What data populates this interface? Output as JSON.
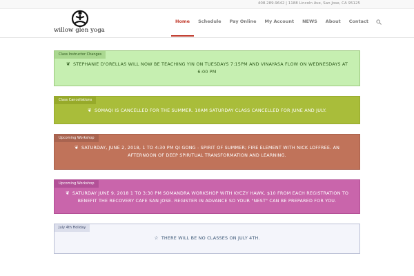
{
  "topbar": {
    "contact": "408.289.9642 | 1188 Lincoln Ave, San Jose, CA 95125"
  },
  "logo": {
    "name": "willow glen yoga",
    "icon": "yoga-figure-icon"
  },
  "nav": {
    "items": [
      {
        "label": "Home",
        "active": true
      },
      {
        "label": "Schedule"
      },
      {
        "label": "Pay Online"
      },
      {
        "label": "My Account"
      },
      {
        "label": "NEWS"
      },
      {
        "label": "About"
      },
      {
        "label": "Contact"
      }
    ],
    "search_icon": "search-icon"
  },
  "notices": [
    {
      "tag": "Class Instructor Changes",
      "text": "Stephanie D'Orellas will now be teaching YIN on Tuesdays 7:15pm and VINAYASA FLOW on Wednesdays at 6:00 pm",
      "icon": "leaf-icon",
      "color": "#c6efb1"
    },
    {
      "tag": "Class Cancellations",
      "text": "Somaqi is cancelled for the summer. 10am Saturday class cancelled for June and July.",
      "icon": "leaf-icon",
      "color": "#a9bd3a"
    },
    {
      "tag": "Upcoming Workshop",
      "text": "Saturday, June 2, 2018, 1 to 4:30 pm Qi Gong - Spirit of Summer; Fire Element with Nick Loffree. An afternoon of deep spiritual transformation and learning.",
      "icon": "leaf-icon",
      "color": "#c0735a"
    },
    {
      "tag": "Upcoming Workshop",
      "text": "Saturday June 9, 2018 1 to 3:30 pm SomaNdra Workshop with Kyczy Hawk. $10 from each registration to benefit The Recovery Cafe San Jose. Register in advance so your \"nest\" can be prepared for you.",
      "icon": "leaf-icon",
      "color": "#c965ab"
    },
    {
      "tag": "July 4th Holiday",
      "text": "There will be no classes on July 4th.",
      "icon": "star-icon",
      "color": "#f4f5fb"
    }
  ]
}
